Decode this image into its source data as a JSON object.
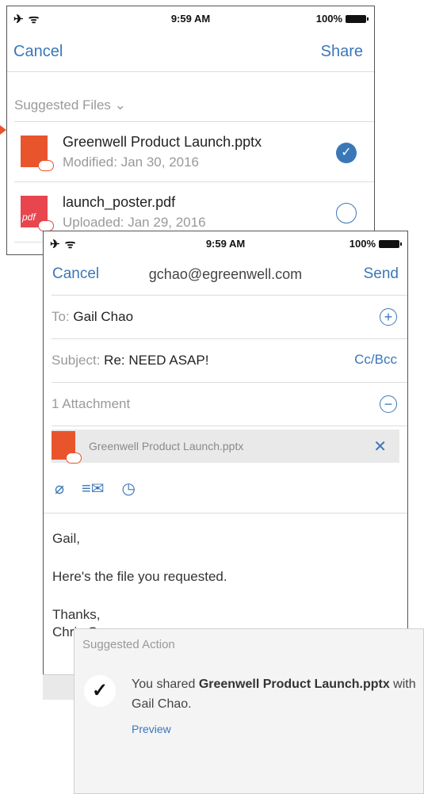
{
  "screen1": {
    "status": {
      "left": "✈ ᯤ",
      "time": "9:59 AM",
      "battery": "100%"
    },
    "nav": {
      "cancel": "Cancel",
      "share": "Share"
    },
    "suggested_header": "Suggested Files ⌄",
    "files": [
      {
        "name": "Greenwell Product Launch.pptx",
        "meta": "Modified: Jan 30, 2016",
        "icon": "pptx-file-icon",
        "selected": true
      },
      {
        "name": "launch_poster.pdf",
        "meta": "Uploaded: Jan 29, 2016",
        "icon": "pdf-file-icon",
        "selected": false
      }
    ],
    "pdf_label": "pdf",
    "check_mark": "✓"
  },
  "screen2": {
    "status": {
      "left": "✈ ᯤ",
      "time": "9:59 AM",
      "battery": "100%"
    },
    "nav": {
      "cancel": "Cancel",
      "account": "gchao@egreenwell.com",
      "send": "Send"
    },
    "to_label": "To:",
    "to_value": "Gail Chao",
    "add_symbol": "+",
    "subject_label": "Subject:",
    "subject_value": "Re: NEED ASAP!",
    "ccbcc": "Cc/Bcc",
    "attachments_label": "1 Attachment",
    "collapse_symbol": "−",
    "attachment": {
      "name": "Greenwell Product Launch.pptx",
      "remove": "✕"
    },
    "tools": {
      "paperclip": "⌀",
      "mail": "≡✉",
      "clock": "◷"
    },
    "body": {
      "greeting": "Gail,",
      "line1": "Here's the file you requested.",
      "closing": "Thanks,",
      "signature": "Chris Grammer"
    }
  },
  "card": {
    "title": "Suggested Action",
    "check": "✓",
    "msg_prefix": "You shared ",
    "msg_file": "Greenwell Product Launch.pptx",
    "msg_suffix": " with Gail Chao.",
    "preview": "Preview"
  },
  "colors": {
    "accent": "#3a77b8",
    "pptx": "#e8552d",
    "pdf": "#e8454f"
  }
}
